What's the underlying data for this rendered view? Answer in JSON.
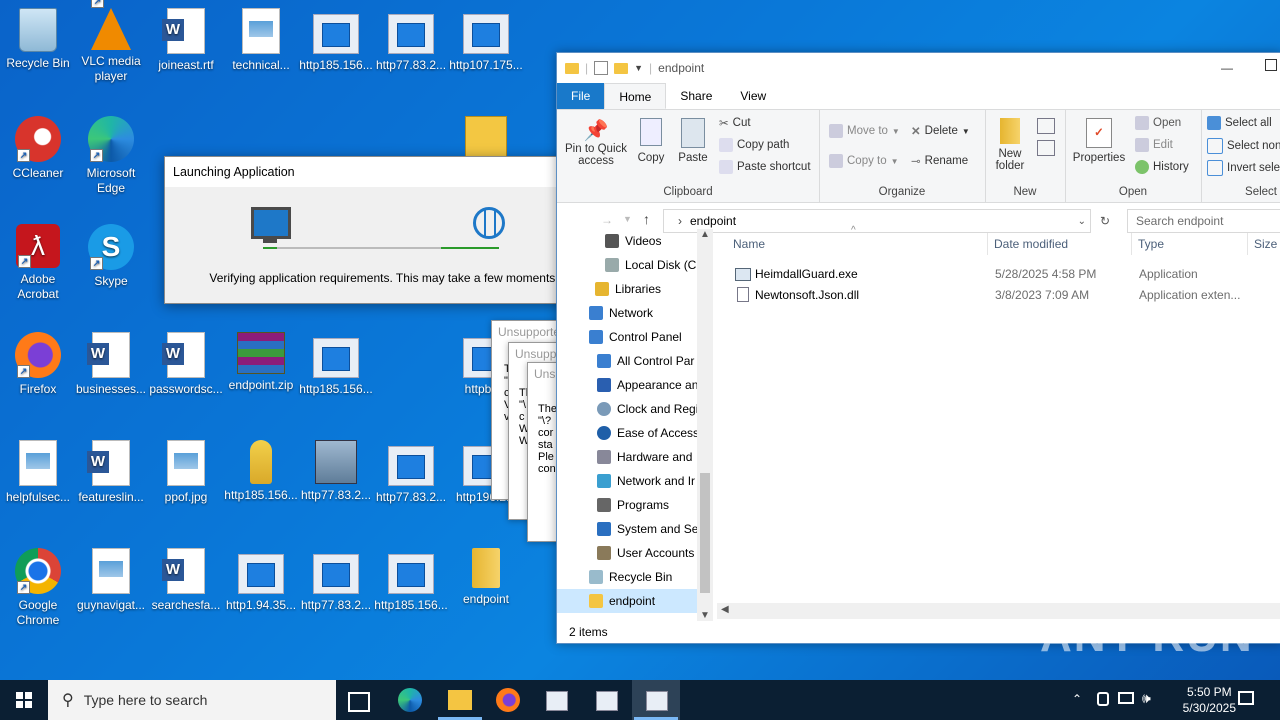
{
  "desktop": {
    "icons": [
      {
        "label": "Recycle Bin",
        "icon": "recycle-bin-icon"
      },
      {
        "label": "VLC media player",
        "icon": "vlc-icon"
      },
      {
        "label": "joineast.rtf",
        "icon": "word-doc-icon"
      },
      {
        "label": "technical...",
        "icon": "image-file-icon"
      },
      {
        "label": "http185.156...",
        "icon": "web-file-icon"
      },
      {
        "label": "http77.83.2...",
        "icon": "web-file-icon"
      },
      {
        "label": "http107.175...",
        "icon": "web-file-icon"
      },
      {
        "label": "CCleaner",
        "icon": "ccleaner-icon"
      },
      {
        "label": "Microsoft Edge",
        "icon": "edge-icon"
      },
      {
        "label": "Adobe Acrobat",
        "icon": "acrobat-icon"
      },
      {
        "label": "Skype",
        "icon": "skype-icon"
      },
      {
        "label": "Firefox",
        "icon": "firefox-icon"
      },
      {
        "label": "businesses...",
        "icon": "word-doc-icon"
      },
      {
        "label": "passwordsc...",
        "icon": "word-doc-icon"
      },
      {
        "label": "endpoint.zip",
        "icon": "winrar-icon"
      },
      {
        "label": "http185.156...",
        "icon": "web-file-icon"
      },
      {
        "label": "httpbk...",
        "icon": "web-file-icon"
      },
      {
        "label": "helpfulsec...",
        "icon": "image-file-icon"
      },
      {
        "label": "featureslin...",
        "icon": "word-doc-icon"
      },
      {
        "label": "ppof.jpg",
        "icon": "image-file-icon"
      },
      {
        "label": "http185.156...",
        "icon": "key-icon"
      },
      {
        "label": "http77.83.2...",
        "icon": "installer-icon"
      },
      {
        "label": "http77.83.2...",
        "icon": "web-file-icon"
      },
      {
        "label": "http196.2...",
        "icon": "web-file-icon"
      },
      {
        "label": "Google Chrome",
        "icon": "chrome-icon"
      },
      {
        "label": "guynavigat...",
        "icon": "image-file-icon"
      },
      {
        "label": "searchesfa...",
        "icon": "word-doc-icon"
      },
      {
        "label": "http1.94.35...",
        "icon": "web-file-icon"
      },
      {
        "label": "http77.83.2...",
        "icon": "shield-web-icon"
      },
      {
        "label": "http185.156...",
        "icon": "shield-web-icon"
      },
      {
        "label": "endpoint",
        "icon": "folder-icon"
      }
    ]
  },
  "dialog": {
    "title": "Launching Application",
    "message": "Verifying application requirements. This may take a few moments."
  },
  "errors": {
    "title1": "Unsupporte",
    "title2": "Unsupp",
    "title3": "Unsu",
    "frag1": "T\n\"\nc\nV\nv",
    "frag2": "Th\n\"\\\nc\nW\nW",
    "frag3": "The\n\"\\?\ncor\nsta\nPle\ncon"
  },
  "explorer": {
    "title": "endpoint",
    "tabs": {
      "file": "File",
      "home": "Home",
      "share": "Share",
      "view": "View"
    },
    "ribbon": {
      "pin": "Pin to Quick access",
      "copy": "Copy",
      "paste": "Paste",
      "cut": "Cut",
      "copy_path": "Copy path",
      "paste_shortcut": "Paste shortcut",
      "clipboard": "Clipboard",
      "move_to": "Move to",
      "copy_to": "Copy to",
      "delete": "Delete",
      "rename": "Rename",
      "organize": "Organize",
      "new_folder": "New folder",
      "new": "New",
      "properties": "Properties",
      "open": "Open",
      "edit": "Edit",
      "history": "History",
      "open_group": "Open",
      "select_all": "Select all",
      "select_none": "Select non",
      "invert": "Invert selec",
      "select": "Select"
    },
    "address": "endpoint",
    "search_placeholder": "Search endpoint",
    "nav": [
      {
        "label": "Videos"
      },
      {
        "label": "Local Disk (C:)"
      },
      {
        "label": "Libraries"
      },
      {
        "label": "Network"
      },
      {
        "label": "Control Panel"
      },
      {
        "label": "All Control Par"
      },
      {
        "label": "Appearance an"
      },
      {
        "label": "Clock and Regi"
      },
      {
        "label": "Ease of Access"
      },
      {
        "label": "Hardware and"
      },
      {
        "label": "Network and Ir"
      },
      {
        "label": "Programs"
      },
      {
        "label": "System and Se"
      },
      {
        "label": "User Accounts"
      },
      {
        "label": "Recycle Bin"
      },
      {
        "label": "endpoint"
      }
    ],
    "columns": {
      "name": "Name",
      "date": "Date modified",
      "type": "Type",
      "size": "Size"
    },
    "files": [
      {
        "name": "HeimdallGuard.exe",
        "date": "5/28/2025 4:58 PM",
        "type": "Application"
      },
      {
        "name": "Newtonsoft.Json.dll",
        "date": "3/8/2023 7:09 AM",
        "type": "Application exten..."
      }
    ],
    "status": "2 items"
  },
  "taskbar": {
    "search_placeholder": "Type here to search",
    "time": "5:50 PM",
    "date": "5/30/2025"
  },
  "watermark": "ANY RUN"
}
